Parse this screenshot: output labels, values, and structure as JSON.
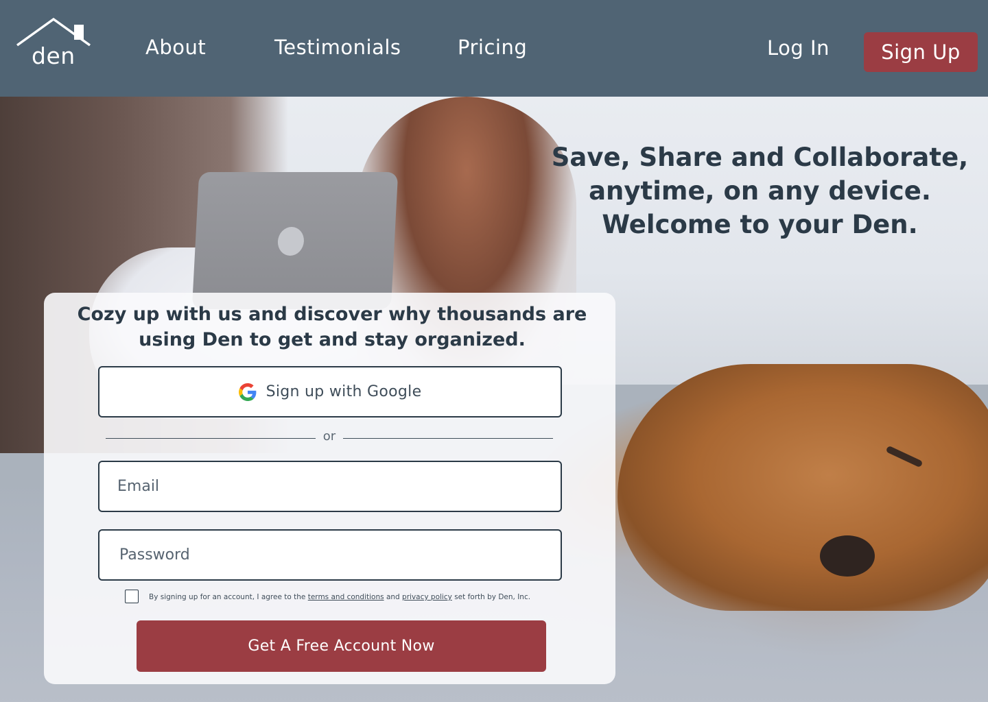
{
  "brand": {
    "logo_text": "den"
  },
  "nav": {
    "about": "About",
    "testimonials": "Testimonials",
    "pricing": "Pricing",
    "login": "Log In",
    "signup": "Sign Up"
  },
  "hero": {
    "headline_line1": "Save, Share and Collaborate,",
    "headline_line2": "anytime, on any device.",
    "headline_line3": "Welcome to your Den."
  },
  "signup_card": {
    "heading_line1": "Cozy up with us and discover why thousands are",
    "heading_line2": "using Den to get and stay organized.",
    "google_button": "Sign up with Google",
    "divider": "or",
    "email_placeholder": "Email",
    "password_placeholder": "Password",
    "terms_prefix": "By signing up for an account, I agree to the",
    "terms_link": "terms and conditions",
    "terms_and": "and",
    "privacy_link": "privacy policy",
    "terms_suffix": "set forth by Den, Inc.",
    "cta_button": "Get A Free Account Now"
  },
  "colors": {
    "navbar": "#506474",
    "accent": "#9b3d43",
    "text_dark": "#2b3a47"
  },
  "icons": {
    "logo": "house-roof-icon",
    "google": "google-g-icon"
  }
}
